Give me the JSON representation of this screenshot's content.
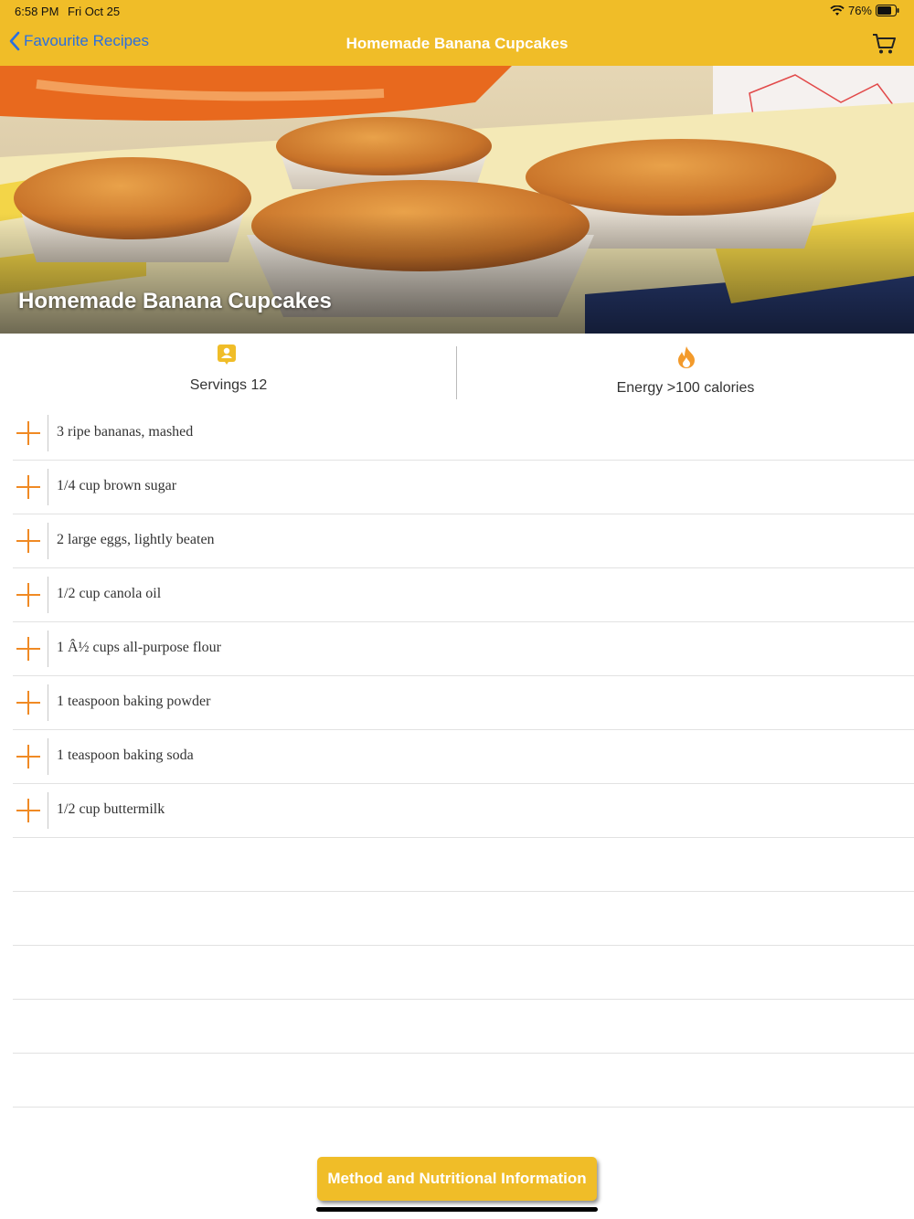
{
  "status_bar": {
    "time": "6:58 PM",
    "date": "Fri Oct 25",
    "battery": "76%"
  },
  "nav": {
    "back_label": "Favourite Recipes",
    "title": "Homemade Banana Cupcakes"
  },
  "hero": {
    "title": "Homemade Banana Cupcakes"
  },
  "info": {
    "servings": "Servings 12",
    "energy": "Energy >100 calories"
  },
  "ingredients": [
    "3 ripe bananas, mashed",
    "1/4 cup brown sugar",
    "2 large eggs, lightly beaten",
    "1/2 cup canola oil",
    "1 Â½ cups all-purpose flour",
    "1 teaspoon baking powder",
    "1 teaspoon baking soda",
    "1/2 cup buttermilk",
    "",
    "",
    "",
    "",
    "",
    ""
  ],
  "cta_label": "Method and Nutritional Information",
  "colors": {
    "accent": "#f0bd28",
    "link": "#2a6fe0",
    "plus": "#f08a24"
  },
  "icons": {
    "servings": "person-badge-icon",
    "energy": "flame-icon",
    "cart": "cart-icon",
    "back": "chevron-left-icon"
  }
}
